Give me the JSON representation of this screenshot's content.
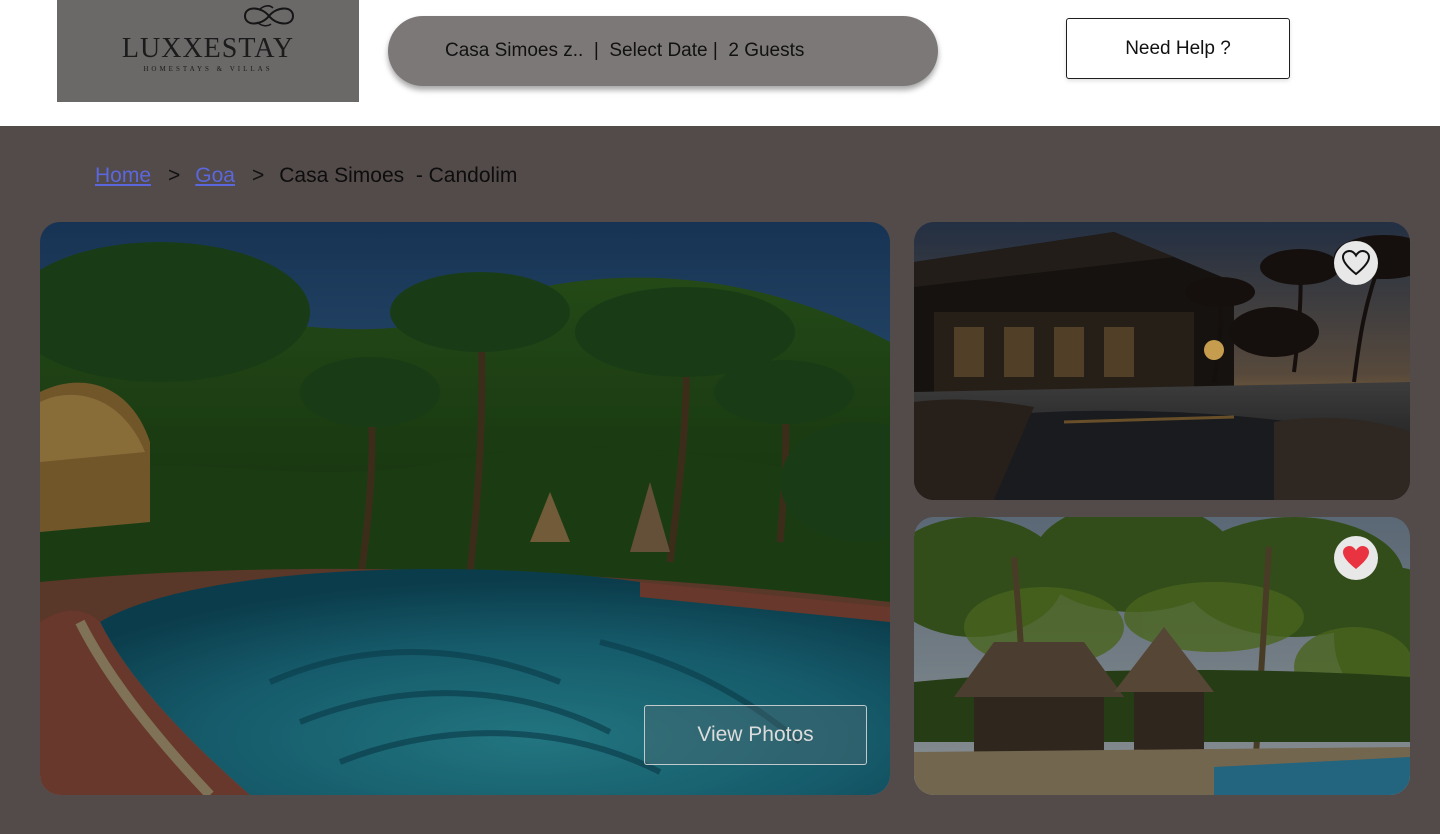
{
  "brand": {
    "name": "LUXXESTAY",
    "tagline": "HOMESTAYS & VILLAS",
    "logo_icon": "infinity-swirl-icon"
  },
  "search": {
    "summary": "Casa Simoes z..  |  Select Date |  2 Guests"
  },
  "header": {
    "help_label": "Need Help ?"
  },
  "breadcrumb": {
    "items": [
      {
        "label": "Home"
      },
      {
        "label": "Goa"
      },
      {
        "label": "Casa Simoes  - Candolim"
      }
    ],
    "separator": ">"
  },
  "gallery": {
    "view_photos_label": "View Photos",
    "photos": [
      {
        "alt": "",
        "icon": "resort-pool-palms-photo"
      },
      {
        "alt": "",
        "icon": "villa-pool-sunset-photo",
        "favorite_icon": "heart-outline-icon",
        "favorited": false
      },
      {
        "alt": "",
        "icon": "beach-gazebo-palms-photo",
        "favorite_icon": "heart-filled-icon",
        "favorited": true
      }
    ]
  },
  "colors": {
    "page_bg": "#534a4a",
    "logo_bg": "#6b6868",
    "search_bg": "#7d7878",
    "link": "#5b67dc",
    "heart_red": "#ea3340"
  }
}
